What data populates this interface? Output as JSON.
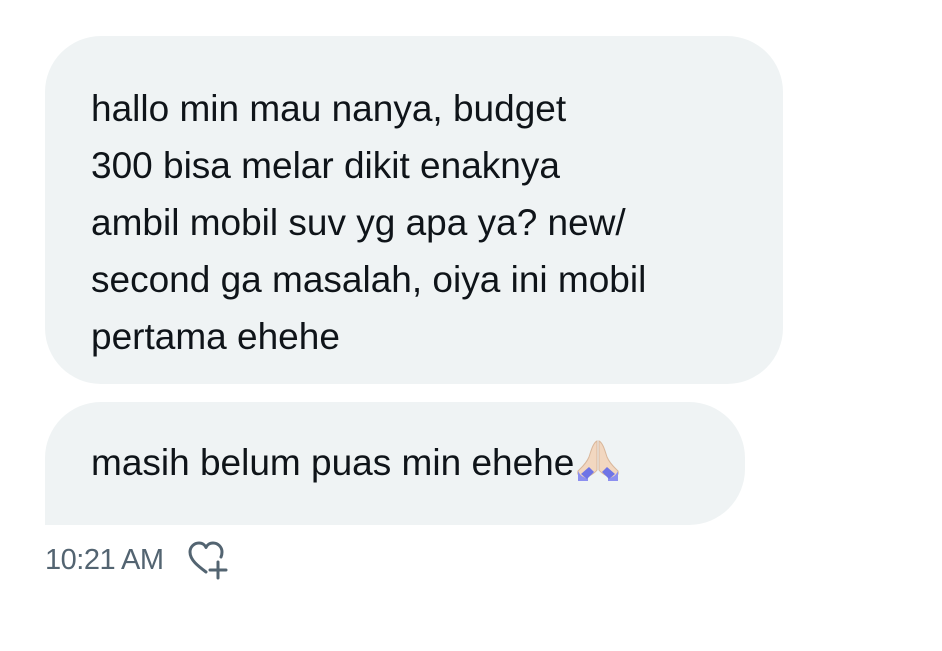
{
  "messages": [
    {
      "lines": [
        "hallo min mau nanya, budget",
        "300 bisa melar dikit enaknya",
        "ambil mobil suv yg apa ya? new/",
        "second ga masalah, oiya ini mobil",
        "pertama ehehe"
      ]
    },
    {
      "text": "masih belum puas min ehehe",
      "emoji": "folded-hands"
    }
  ],
  "meta": {
    "timestamp": "10:21 AM",
    "react_icon": "heart-plus-icon"
  },
  "colors": {
    "bubble_bg": "#eff3f4",
    "text": "#0f1419",
    "muted": "#536471"
  }
}
